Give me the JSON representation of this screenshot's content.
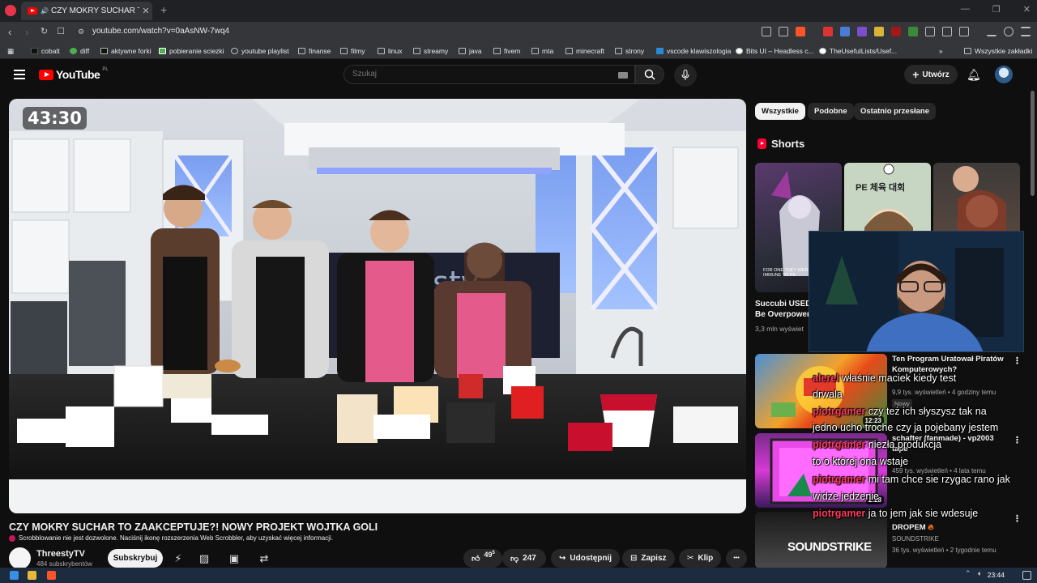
{
  "browser": {
    "tab_title": "CZY MOKRY SUCHAR TO ZAAC",
    "url": "youtube.com/watch?v=0aAsNW-7wq4",
    "bookmarks": [
      "cobalt",
      "diff",
      "aktywne forki",
      "pobieranie sciezki",
      "youtube playlist",
      "finanse",
      "filmy",
      "linux",
      "streamy",
      "java",
      "fivem",
      "mta",
      "minecraft",
      "strony",
      "vscode klawiszologia",
      "Bits UI – Headless c...",
      "TheUsefulLists/Usef..."
    ],
    "all_bookmarks": "Wszystkie zakładki",
    "more_bookmarks": "»"
  },
  "header": {
    "logo_text": "YouTube",
    "logo_region": "PL",
    "search_placeholder": "Szukaj",
    "create_label": "Utwórz"
  },
  "video": {
    "timer": "43:30",
    "title": "CZY MOKRY SUCHAR TO ZAAKCEPTUJE?! NOWY PROJEKT WOJTKA GOLI",
    "scrobble_notice": "Scrobblowanie nie jest dozwolone. Naciśnij ikonę rozszerzenia Web Scrobbler, aby uzyskać więcej informacji.",
    "channel_name": "ThreestyTV",
    "channel_subs": "484 subskrybentów",
    "subscribe_label": "Subskrybuj",
    "likes_main": "49",
    "likes_sup": "5",
    "dislikes": "247",
    "share_label": "Udostępnij",
    "save_label": "Zapisz",
    "clip_label": "Klip",
    "more_label": "•••"
  },
  "sidebar": {
    "chips": [
      "Wszystkie",
      "Podobne",
      "Ostatnio przesłane"
    ],
    "shorts_heading": "Shorts",
    "short_thumb_text_1": "FOR ONE THEY WERE C... IMMUNE TO PE",
    "short_thumb_text_2": "PE 체육 대회",
    "short1_title_1": "Succubi USED",
    "short1_title_2": "Be Overpower",
    "short1_views": "3,3 mln wyświet",
    "recs": [
      {
        "title": "Ten Program Uratował Piratów Komputerowych?",
        "meta1": "9,9 tys. wyświetleń • 4 godziny temu",
        "badge": "Nowy",
        "duration": "12:23"
      },
      {
        "title": "schafter (fanmade) - vp2003 tape",
        "meta1": "459 tys. wyświetleń • 4 lata temu",
        "duration": "2:28"
      },
      {
        "title": "DROPEM",
        "channel": "SOUNDSTRIKE",
        "meta1": "36 tys. wyświetleń • 2 tygodnie temu",
        "thumb_text": "SOUNDSTRIKE"
      }
    ]
  },
  "chat": [
    {
      "nick": "alerel",
      "msg": "właśnie maciek kiedy test"
    },
    {
      "nick": "",
      "msg": "drwala"
    },
    {
      "nick": "piotrgamer",
      "msg": "czy też ich słyszysz tak na"
    },
    {
      "nick": "",
      "msg": "jedno ucho troche czy ja pojebany jestem"
    },
    {
      "nick": "piotrgamer",
      "msg": "niezła produkcja"
    },
    {
      "nick": "",
      "msg": "to o której ona wstaje"
    },
    {
      "nick": "piotrgamer",
      "msg": "mi tam chce sie rzygac rano jak"
    },
    {
      "nick": "",
      "msg": "widze jedzenie"
    },
    {
      "nick": "piotrgamer",
      "msg": "ja to jem jak sie wdesuje"
    }
  ],
  "taskbar": {
    "time": "23:44"
  },
  "colors": {
    "accent_red": "#ff0000",
    "chat_nick": "#ff3b5c",
    "bg": "#0f0f0f"
  }
}
